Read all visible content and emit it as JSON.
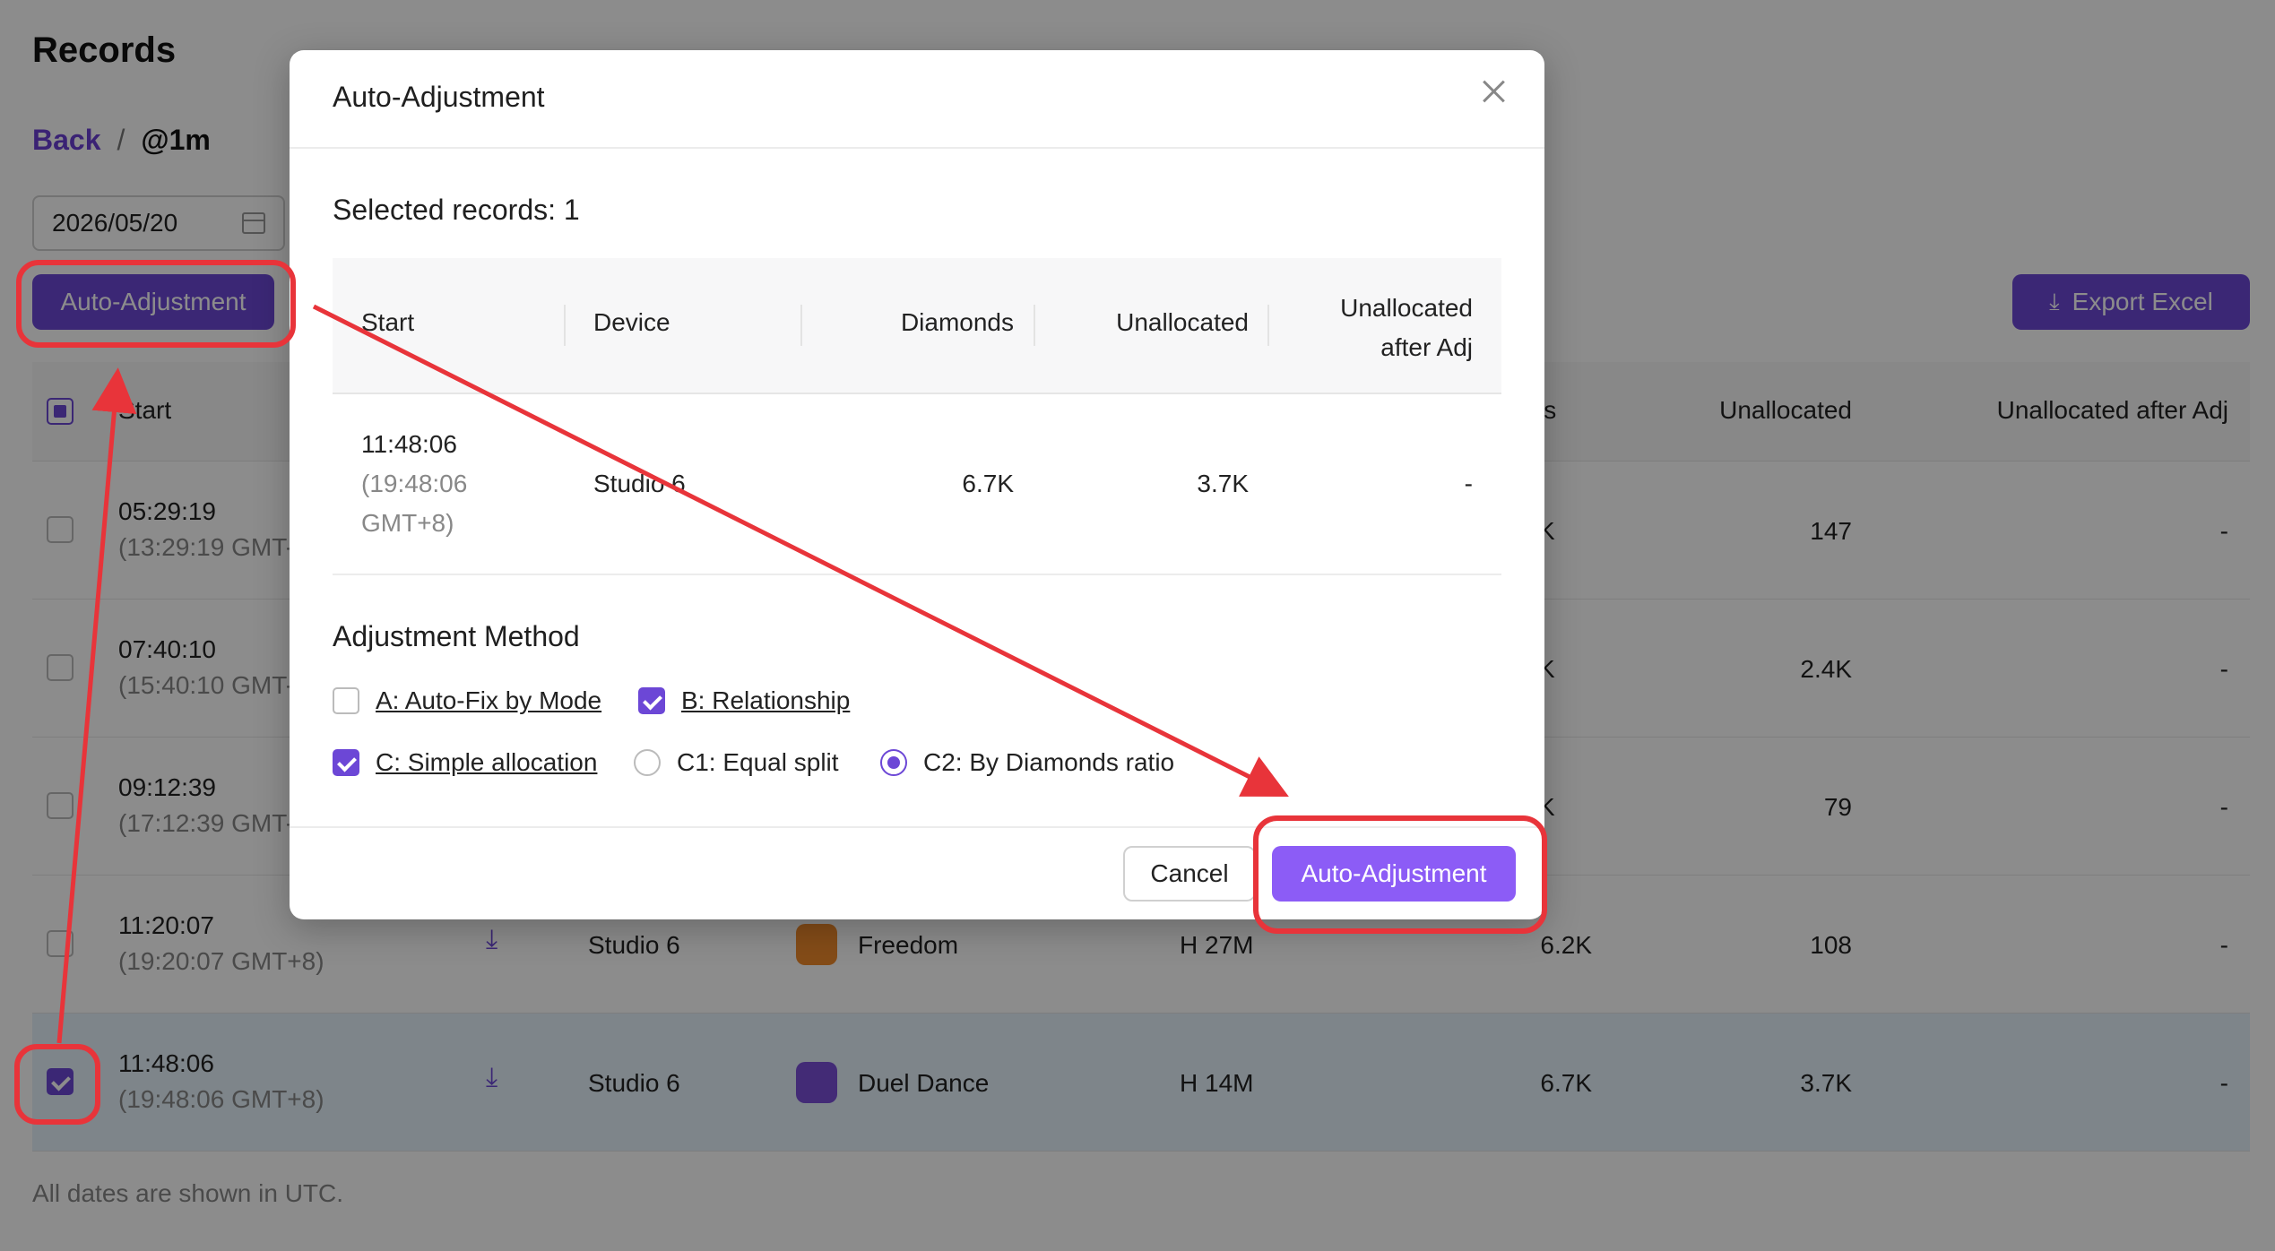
{
  "page": {
    "title": "Records",
    "breadcrumb": {
      "back": "Back",
      "separator": "/",
      "current": "@1m"
    },
    "date": "2026/05/20",
    "auto_adjust_label": "Auto-Adjustment",
    "export_label": "Export Excel",
    "footnote": "All dates are shown in UTC."
  },
  "table": {
    "headers": {
      "start": "Start",
      "diamonds": "ls",
      "unallocated": "Unallocated",
      "unallocated_after": "Unallocated after Adj"
    },
    "rows": [
      {
        "time": "05:29:19",
        "sub": "(13:29:19 GMT-",
        "device": "",
        "app": "",
        "duration": "",
        "diamonds": "K",
        "unallocated": "147",
        "after": "-",
        "checked": false
      },
      {
        "time": "07:40:10",
        "sub": "(15:40:10 GMT-",
        "device": "",
        "app": "",
        "duration": "",
        "diamonds": "K",
        "unallocated": "2.4K",
        "after": "-",
        "checked": false
      },
      {
        "time": "09:12:39",
        "sub": "(17:12:39 GMT-",
        "device": "",
        "app": "",
        "duration": "",
        "diamonds": "K",
        "unallocated": "79",
        "after": "-",
        "checked": false
      },
      {
        "time": "11:20:07",
        "sub": "(19:20:07 GMT+8)",
        "device": "Studio 6",
        "app": "Freedom",
        "duration": "H 27M",
        "diamonds": "6.2K",
        "unallocated": "108",
        "after": "-",
        "checked": false
      },
      {
        "time": "11:48:06",
        "sub": "(19:48:06 GMT+8)",
        "device": "Studio 6",
        "app": "Duel Dance",
        "duration": "H 14M",
        "diamonds": "6.7K",
        "unallocated": "3.7K",
        "after": "-",
        "checked": true
      }
    ]
  },
  "modal": {
    "title": "Auto-Adjustment",
    "selected": "Selected records: 1",
    "headers": {
      "start": "Start",
      "device": "Device",
      "diamonds": "Diamonds",
      "unallocated": "Unallocated",
      "after_line1": "Unallocated",
      "after_line2": "after Adj"
    },
    "row": {
      "time": "11:48:06",
      "sub1": "(19:48:06",
      "sub2": "GMT+8)",
      "device": "Studio 6",
      "diamonds": "6.7K",
      "unallocated": "3.7K",
      "after": "-"
    },
    "method_title": "Adjustment Method",
    "options": {
      "a": "A: Auto-Fix by Mode",
      "b": "B: Relationship",
      "c": "C: Simple allocation",
      "c1": "C1: Equal split",
      "c2": "C2: By Diamonds ratio"
    },
    "cancel": "Cancel",
    "confirm": "Auto-Adjustment"
  },
  "colors": {
    "accent": "#6c47d6",
    "button": "#8c5cf6",
    "annotation": "#e8343a"
  }
}
